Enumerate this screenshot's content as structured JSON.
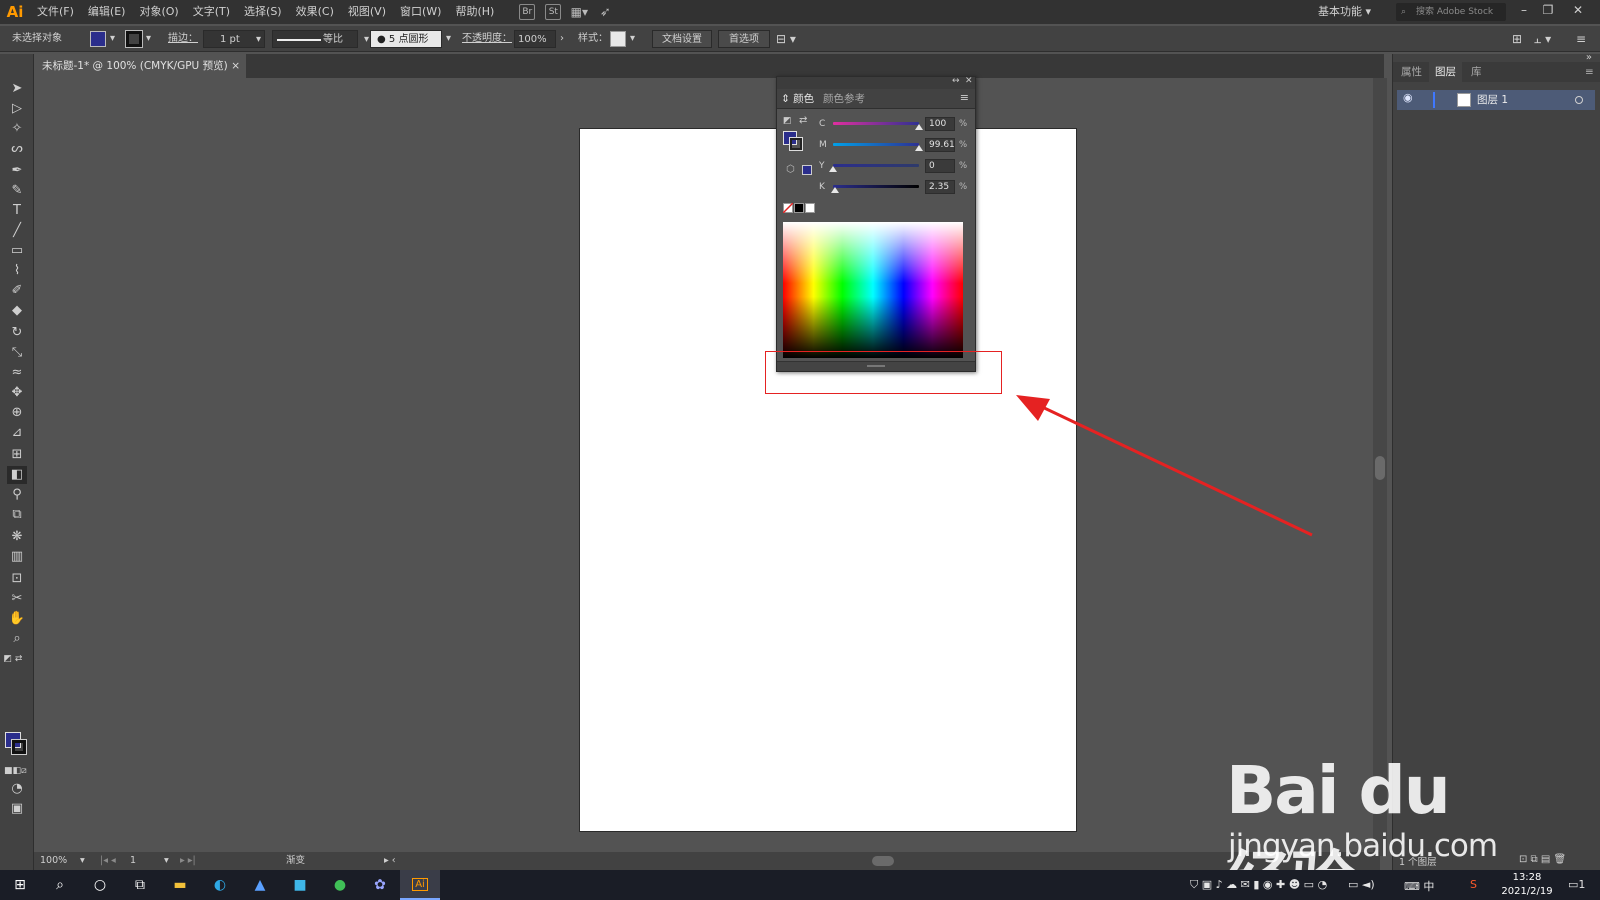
{
  "app": {
    "logo": "Ai"
  },
  "menu": [
    "文件(F)",
    "编辑(E)",
    "对象(O)",
    "文字(T)",
    "选择(S)",
    "效果(C)",
    "视图(V)",
    "窗口(W)",
    "帮助(H)"
  ],
  "menu_icons": {
    "br": "Br",
    "st": "St"
  },
  "workspace": "基本功能",
  "search": {
    "placeholder": "搜索 Adobe Stock"
  },
  "control_bar": {
    "selection": "未选择对象",
    "stroke_label": "描边：",
    "stroke_value": "1 pt",
    "stroke_profile": "等比",
    "brush": "5 点圆形",
    "opacity_label": "不透明度：",
    "opacity_value": "100%",
    "style_label": "样式：",
    "doc_setup": "文档设置",
    "preferences": "首选项"
  },
  "document_tab": {
    "title": "未标题-1* @ 100% (CMYK/GPU 预览)",
    "close": "×"
  },
  "color_panel": {
    "tabs": [
      "颜色",
      "颜色参考"
    ],
    "channels": [
      {
        "label": "C",
        "value": "100",
        "level": 1.0,
        "gradient": [
          "#e02fa0",
          "#2e3192"
        ]
      },
      {
        "label": "M",
        "value": "99.61",
        "level": 0.9961,
        "gradient": [
          "#00a0e9",
          "#2e3192"
        ]
      },
      {
        "label": "Y",
        "value": "0",
        "level": 0.0,
        "gradient": [
          "#2b2e8c",
          "#2e3a6a"
        ]
      },
      {
        "label": "K",
        "value": "2.35",
        "level": 0.0235,
        "gradient": [
          "#2b2e8c",
          "#000000"
        ]
      }
    ],
    "unit": "%"
  },
  "colors": {
    "fill": "#2b2e8c",
    "annotation": "#e52222",
    "layer_highlight": "#4d5b77",
    "accent": "#3f78ff"
  },
  "right_panel": {
    "tabs": [
      "属性",
      "图层",
      "库"
    ],
    "active_tab": "图层",
    "layer_name": "图层 1",
    "layer_count": "1 个图层"
  },
  "status_bar": {
    "zoom": "100%",
    "page": "1",
    "tool": "渐变"
  },
  "watermark": {
    "brand": "Bai du 经验",
    "url": "jingyan.baidu.com"
  },
  "taskbar": {
    "time": "13:28",
    "date": "2021/2/19",
    "ai_label": "Ai",
    "ime": "中",
    "notifications": "1"
  }
}
